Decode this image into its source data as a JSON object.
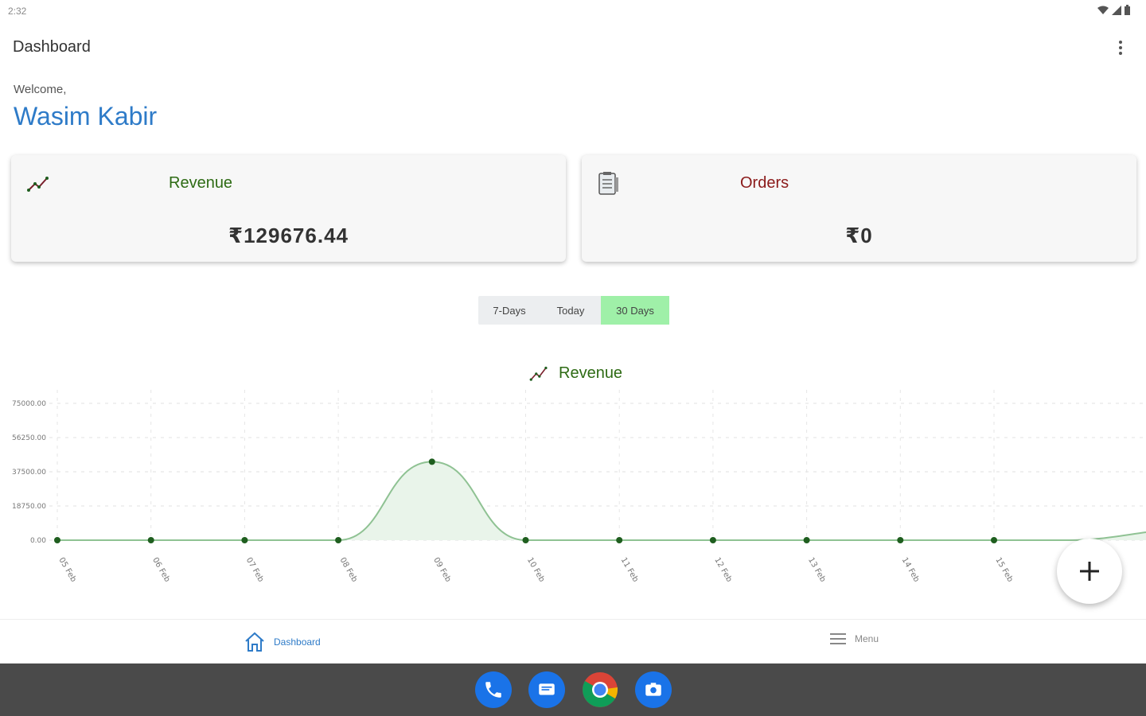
{
  "status_bar": {
    "time": "2:32"
  },
  "app_bar": {
    "title": "Dashboard",
    "more_icon": "more-vert-icon"
  },
  "greeting": {
    "welcome": "Welcome,",
    "name": "Wasim Kabir"
  },
  "cards": {
    "revenue": {
      "title": "Revenue",
      "value": "₹129676.44",
      "icon": "trending-up-icon",
      "title_color": "#2e6b14"
    },
    "orders": {
      "title": "Orders",
      "value": "₹0",
      "icon": "clipboard-icon",
      "title_color": "#8b1a1a"
    }
  },
  "segment": {
    "options": [
      "7-Days",
      "Today",
      "30 Days"
    ],
    "selected": "30 Days",
    "selected_color": "#9ff0a8"
  },
  "chart_title": "Revenue",
  "chart_data": {
    "type": "area",
    "title": "Revenue",
    "y_ticks": [
      "75000.00",
      "56250.00",
      "37500.00",
      "18750.00",
      "0.00"
    ],
    "ylim": [
      0,
      75000
    ],
    "x": [
      "05 Feb",
      "06 Feb",
      "07 Feb",
      "08 Feb",
      "09 Feb",
      "10 Feb",
      "11 Feb",
      "12 Feb",
      "13 Feb",
      "14 Feb",
      "15 Feb"
    ],
    "series": [
      {
        "values": [
          0,
          0,
          0,
          0,
          43000,
          0,
          0,
          0,
          0,
          0,
          0
        ]
      }
    ],
    "grid": true,
    "line_color": "#8fc293",
    "point_color": "#1f5e1f"
  },
  "fab": {
    "icon": "plus-icon"
  },
  "bottom_nav": {
    "items": [
      {
        "label": "Dashboard",
        "icon": "home-icon",
        "active": true
      },
      {
        "label": "Menu",
        "icon": "menu-icon",
        "active": false
      }
    ]
  },
  "taskbar": {
    "apps": [
      "phone-icon",
      "messages-icon",
      "chrome-icon",
      "camera-icon"
    ]
  }
}
